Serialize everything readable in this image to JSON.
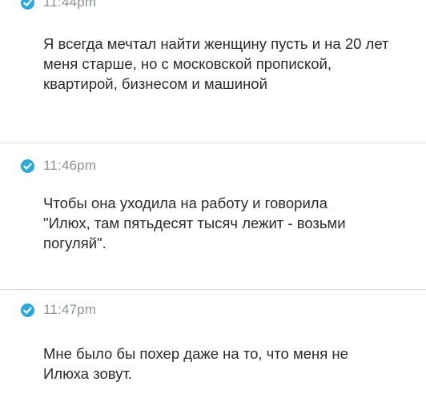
{
  "colors": {
    "icon_blue": "#2aa8e0",
    "timestamp_gray": "#8c949b",
    "text": "#2b2b2b",
    "divider": "#dcdcdc"
  },
  "messages": [
    {
      "time": "11:44pm",
      "status_icon": "check-circle-icon",
      "text": "Я всегда мечтал найти женщину пусть и на 20 лет меня старше, но с московской пропиской,  квартирой,  бизнесом и машиной"
    },
    {
      "time": "11:46pm",
      "status_icon": "check-circle-icon",
      "text": "Чтобы она уходила на работу и говорила \"Илюх, там пятьдесят тысяч лежит - возьми погуляй\"."
    },
    {
      "time": "11:47pm",
      "status_icon": "check-circle-icon",
      "text": "Мне было бы похер даже на то,  что меня не Илюха зовут."
    }
  ]
}
